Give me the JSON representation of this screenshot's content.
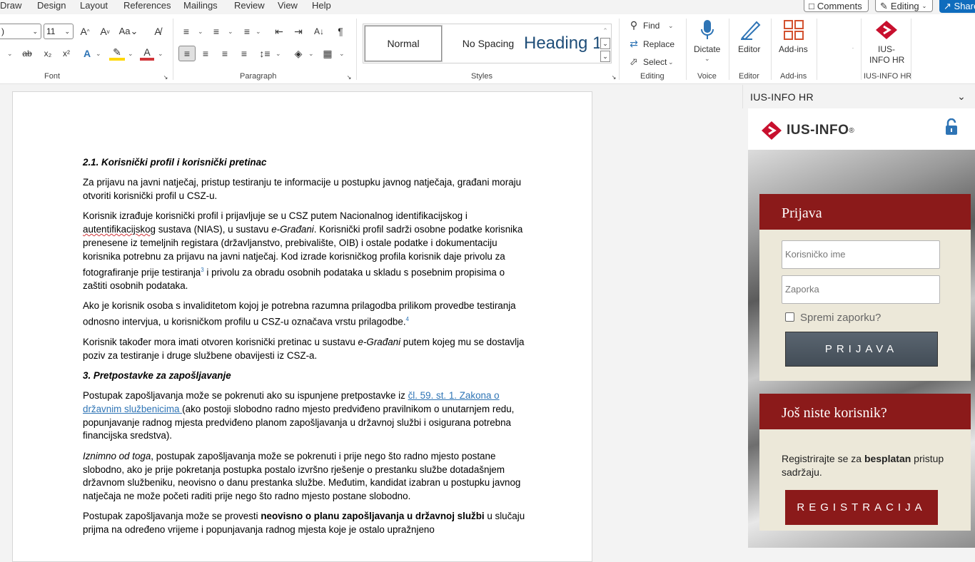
{
  "menu": {
    "items": [
      "Draw",
      "Design",
      "Layout",
      "References",
      "Mailings",
      "Review",
      "View",
      "Help"
    ],
    "comments_label": "Comments",
    "editing_label": "Editing",
    "share_label": "Share"
  },
  "ribbon": {
    "font": {
      "font_name": ")",
      "font_size": "11",
      "group_label": "Font"
    },
    "paragraph": {
      "group_label": "Paragraph"
    },
    "styles": {
      "normal": "Normal",
      "no_spacing": "No Spacing",
      "heading": "Heading 1",
      "group_label": "Styles"
    },
    "editing": {
      "find": "Find",
      "replace": "Replace",
      "select": "Select",
      "group_label": "Editing"
    },
    "voice": {
      "dictate": "Dictate",
      "group_label": "Voice"
    },
    "editor": {
      "label": "Editor",
      "group_label": "Editor"
    },
    "addins": {
      "label": "Add-ins",
      "group_label": "Add-ins"
    },
    "iusinfo": {
      "label_line1": "IUS-",
      "label_line2": "INFO HR",
      "group_label": "IUS-INFO HR"
    }
  },
  "document": {
    "h1": "2.1. Korisnički profil i korisnički pretinac",
    "p1": "Za prijavu na javni natječaj, pristup testiranju te informacije u postupku javnog natječaja, građani moraju otvoriti korisnički profil u CSZ-u.",
    "p2_a": "Korisnik izrađuje korisnički profil i prijavljuje se u CSZ putem Nacionalnog identifikacijskog i ",
    "p2_sq": "autentifikacijskog",
    "p2_b": " sustava (NIAS), u sustavu ",
    "p2_i": "e-Građani",
    "p2_c": ". Korisnički profil sadrži osobne podatke korisnika prenesene iz temeljnih registara (državljanstvo, prebivalište, OIB) i ostale podatke i dokumentaciju korisnika potrebnu za prijavu na javni natječaj. Kod izrade korisničkog profila korisnik daje privolu za fotografiranje prije testiranja",
    "p2_fn": "3",
    "p2_d": " i privolu za obradu osobnih podataka u skladu s posebnim propisima o zaštiti osobnih podataka.",
    "p3_a": "Ako je korisnik osoba s invaliditetom kojoj je potrebna razumna prilagodba prilikom provedbe testiranja odnosno intervjua, u korisničkom profilu u CSZ-u označava vrstu prilagodbe.",
    "p3_fn": "4",
    "p4_a": "Korisnik također mora imati otvoren korisnički pretinac u sustavu ",
    "p4_i": "e-Građani",
    "p4_b": " putem kojeg mu se dostavlja poziv za testiranje i druge službene obavijesti iz CSZ-a.",
    "h2": "3. Pretpostavke za zapošljavanje",
    "p5_a": "Postupak zapošljavanja može se pokrenuti ako su ispunjene pretpostavke iz ",
    "p5_link": "čl. 59. st. 1. Zakona o državnim službenicima ",
    "p5_b": "(ako postoji slobodno radno mjesto predviđeno pravilnikom o unutarnjem redu, popunjavanje radnog mjesta predviđeno planom zapošljavanja u državnoj službi i osigurana potrebna financijska sredstva).",
    "p6_i": "Iznimno od toga",
    "p6_b": ", postupak zapošljavanja može se pokrenuti i prije nego što radno mjesto postane slobodno, ako je prije pokretanja postupka postalo izvršno rješenje o prestanku službe dotadašnjem državnom službeniku, neovisno o danu prestanka službe. Međutim, kandidat izabran u postupku javnog natječaja ne može početi raditi prije nego što radno mjesto postane slobodno.",
    "p7_a": "Postupak zapošljavanja može se provesti ",
    "p7_b": "neovisno o planu zapošljavanja u državnoj službi",
    "p7_c": " u slučaju prijma na određeno vrijeme i popunjavanja radnog mjesta koje je ostalo upražnjeno"
  },
  "pane": {
    "title": "IUS-INFO HR",
    "logo_text": "IUS-INFO",
    "logo_reg": "®",
    "login_title": "Prijava",
    "username_placeholder": "Korisničko ime",
    "password_placeholder": "Zaporka",
    "remember_label": "Spremi zaporku?",
    "login_button": "PRIJAVA",
    "register_title": "Još niste korisnik?",
    "register_text_a": "Registrirajte se za ",
    "register_text_b": "besplatan",
    "register_text_c": " pristup sadržaju.",
    "register_button": "REGISTRACIJA"
  },
  "colors": {
    "accent": "#0f6cbd",
    "brand_red": "#8b1a1a",
    "link": "#2e74b5"
  }
}
